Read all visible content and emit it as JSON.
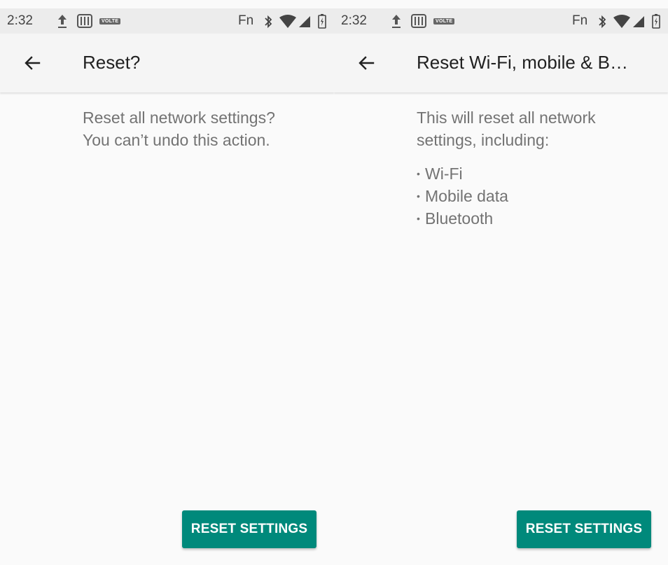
{
  "colors": {
    "accent": "#00897b",
    "background": "#fafafa",
    "appbar": "#f5f5f5",
    "statusbar": "#ececec",
    "title_text": "#212121",
    "body_text": "#737373"
  },
  "left": {
    "status": {
      "time": "2:32",
      "volte": "VOLTE",
      "fn": "Fn",
      "icons": [
        "upload-icon",
        "sim-icon",
        "volte-icon",
        "bluetooth-icon",
        "wifi-icon",
        "cell-signal-icon",
        "battery-icon"
      ]
    },
    "appbar": {
      "back_icon": "arrow-back-icon",
      "title": "Reset?"
    },
    "content": {
      "line1": "Reset all network settings?",
      "line2": "You can’t undo this action."
    },
    "button": {
      "label": "RESET SETTINGS"
    }
  },
  "right": {
    "status": {
      "time": "2:32",
      "volte": "VOLTE",
      "fn": "Fn",
      "icons": [
        "upload-icon",
        "sim-icon",
        "volte-icon",
        "bluetooth-icon",
        "wifi-icon",
        "cell-signal-icon",
        "battery-icon"
      ]
    },
    "appbar": {
      "back_icon": "arrow-back-icon",
      "title": "Reset Wi-Fi, mobile & B…"
    },
    "content": {
      "line1": "This will reset all network",
      "line2": "settings, including:",
      "bullets": [
        "Wi-Fi",
        "Mobile data",
        "Bluetooth"
      ]
    },
    "button": {
      "label": "RESET SETTINGS"
    }
  }
}
